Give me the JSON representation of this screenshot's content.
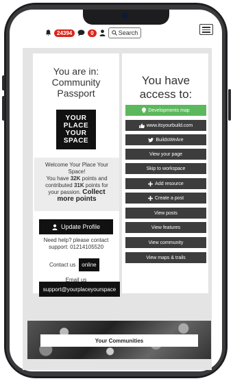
{
  "header": {
    "notifications_count": "24394",
    "messages_count": "0",
    "search_label": "Search"
  },
  "left": {
    "heading_line1": "You are in:",
    "heading_line2": "Community",
    "heading_line3": "Passport",
    "logo_lines": [
      "YOUR",
      "PLACE",
      "YOUR",
      "SPACE"
    ],
    "welcome_line1": "Welcome Your Place Your",
    "welcome_line2": "Space!",
    "points_pre": "You have ",
    "points_value": "32K",
    "points_mid": " points and",
    "contrib_pre": "contributed ",
    "contrib_value": "31K",
    "contrib_post": " points for",
    "passion": "your passion.",
    "collect_line1": "Collect",
    "collect_line2": "more points",
    "update_profile": "Update Profile",
    "help_line1": "Need help? please contact",
    "help_line2": "support: 01214105520",
    "contact_label": "Contact us",
    "online_label": "online",
    "email_label": "Email us",
    "email_address": "support@yourplaceyourspace"
  },
  "right": {
    "heading_line1": "You have",
    "heading_line2": "access to:",
    "buttons": [
      "Developments map",
      "www.itsyourbuild.com",
      "BuildsWeAre",
      "View your page",
      "Skip to workspace",
      "Add resource",
      "Create a post",
      "View posts",
      "View features",
      "View community",
      "View maps & trails"
    ]
  },
  "communities": {
    "label": "Your Communities"
  },
  "colors": {
    "accent_green": "#5cb85c",
    "badge_red": "#d9251c",
    "button_dark": "#3d3d3d"
  }
}
